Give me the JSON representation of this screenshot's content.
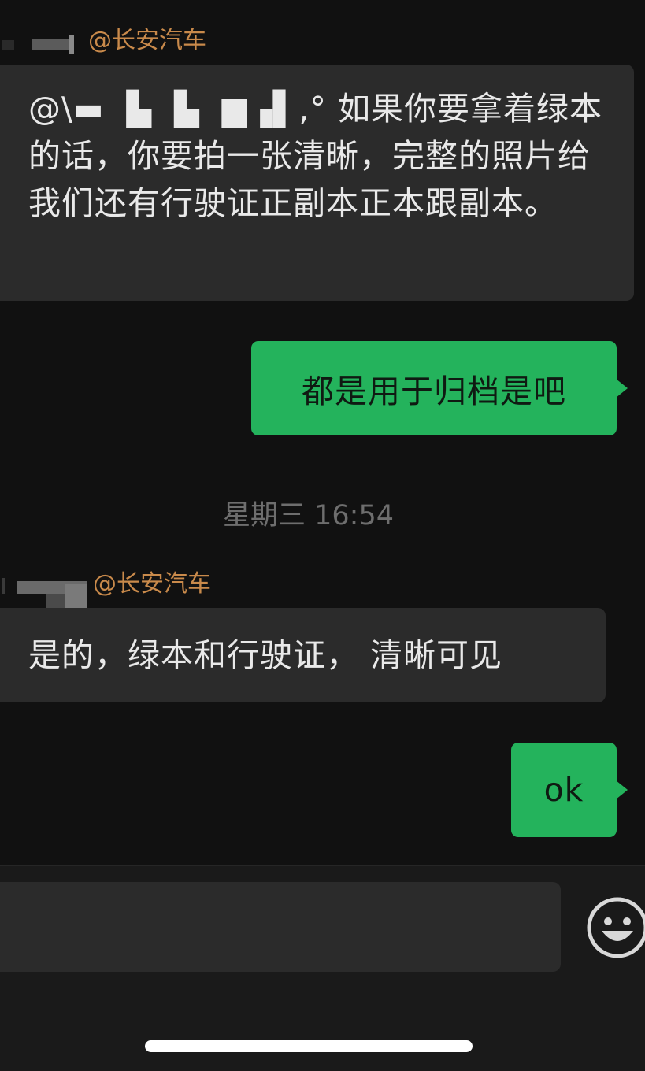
{
  "messages": [
    {
      "sender_label": "@长安汽车",
      "text": "@\\▬  ▙  ▙  ▆▗▌,° 如果你要拿着绿本的话，你要拍一张清晰，完整的照片给我们还有行驶证正副本正本跟副本。"
    },
    {
      "text": "都是用于归档是吧"
    },
    {
      "timestamp": "星期三 16:54"
    },
    {
      "sender_label": "@长安汽车",
      "text": "是的，绿本和行驶证， 清晰可见"
    },
    {
      "text": "ok"
    }
  ],
  "input": {
    "placeholder": "",
    "emoji_button_icon": "smiley-face-icon"
  },
  "colors": {
    "background": "#111111",
    "incoming_bubble": "#2b2b2b",
    "outgoing_bubble": "#24b35c",
    "sender_label": "#c98a4b",
    "timestamp": "#6e6e6e"
  }
}
